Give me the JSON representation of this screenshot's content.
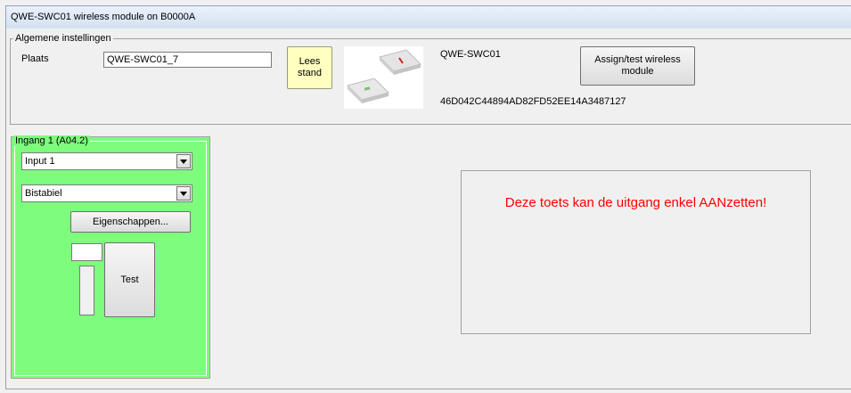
{
  "window": {
    "title": "QWE-SWC01 wireless module on B0000A"
  },
  "general": {
    "legend": "Algemene instellingen",
    "location_label": "Plaats",
    "location_value": "QWE-SWC01_7",
    "read_button": "Lees stand",
    "module_name": "QWE-SWC01",
    "module_id": "46D042C44894AD82FD52EE14A3487127",
    "assign_button": "Assign/test wireless module"
  },
  "input_group": {
    "legend": "Ingang 1 (A04.2)",
    "input_select": "Input 1",
    "mode_select": "Bistabiel",
    "properties_button": "Eigenschappen...",
    "test_button": "Test"
  },
  "message": {
    "text": "Deze toets kan de uitgang enkel AANzetten!"
  },
  "colors": {
    "panel_green": "#7dfc7d",
    "message_red": "#ff0000",
    "button_yellow": "#ffffc0"
  },
  "icons": [
    "chevron-down-icon",
    "wireless-module-image"
  ]
}
